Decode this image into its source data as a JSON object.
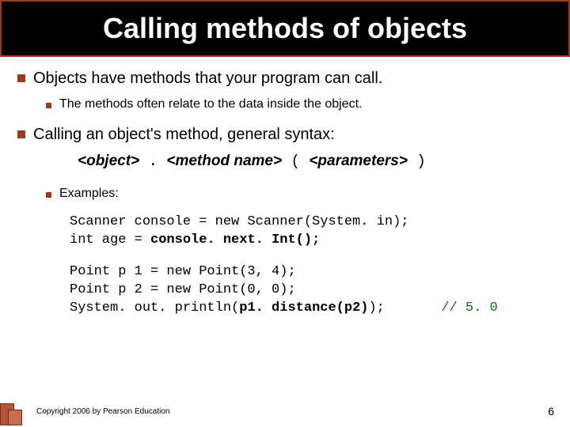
{
  "title": "Calling methods of objects",
  "bullets": {
    "b1": "Objects have methods that your program can call.",
    "b1a": "The methods often relate to the data inside the object.",
    "b2": "Calling an object's method, general syntax:",
    "examples_label": "Examples:"
  },
  "syntax": {
    "object": "<object>",
    "dot": " . ",
    "method": "<method name>",
    "lparen": " ( ",
    "params": "<parameters>",
    "rparen": " )"
  },
  "code1_line1_a": "Scanner console = new Scanner(System. in);",
  "code1_line2_a": "int age = ",
  "code1_line2_b": "console. next. Int();",
  "code2_line1": "Point p 1 = new Point(3, 4);",
  "code2_line2": "Point p 2 = new Point(0, 0);",
  "code2_line3_a": "System. out. println(",
  "code2_line3_b": "p1. distance(p2)",
  "code2_line3_c": ");",
  "code2_comment": "// 5. 0",
  "footer": "Copyright 2006 by Pearson Education",
  "pagenum": "6"
}
